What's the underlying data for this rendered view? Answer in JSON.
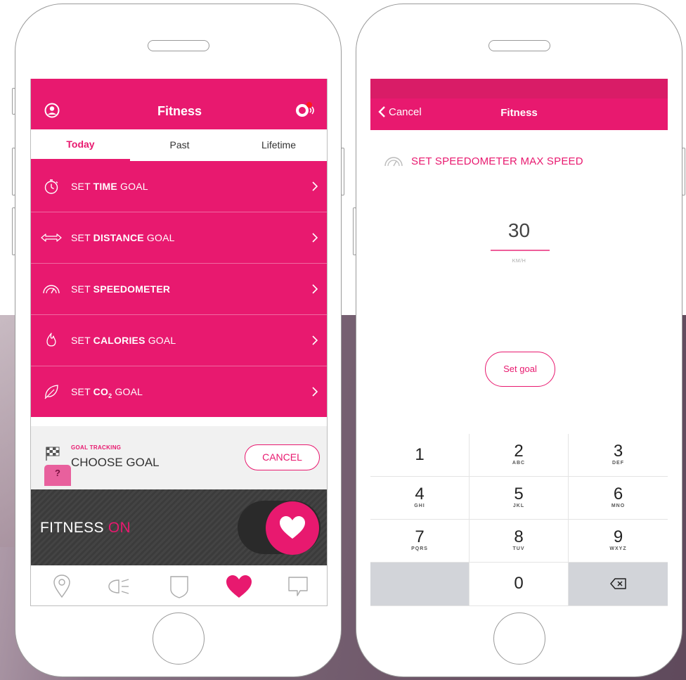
{
  "screen_a": {
    "header": {
      "title": "Fitness"
    },
    "tabs": [
      {
        "label": "Today"
      },
      {
        "label": "Past"
      },
      {
        "label": "Lifetime"
      }
    ],
    "menu": [
      {
        "pre": "SET ",
        "bold": "TIME",
        "post": " GOAL",
        "icon": "stopwatch-icon"
      },
      {
        "pre": "SET ",
        "bold": "DISTANCE",
        "post": " GOAL",
        "icon": "distance-arrows-icon"
      },
      {
        "pre": "SET ",
        "bold": "SPEEDOMETER",
        "post": "",
        "icon": "speedometer-icon"
      },
      {
        "pre": "SET ",
        "bold": "CALORIES",
        "post": " GOAL",
        "icon": "flame-icon"
      },
      {
        "pre": "SET ",
        "bold": "CO",
        "sub": "2",
        "post": " GOAL",
        "icon": "leaf-icon"
      }
    ],
    "goal": {
      "small": "GOAL TRACKING",
      "big": "CHOOSE GOAL",
      "cancel": "CANCEL",
      "help": "?"
    },
    "fitness": {
      "label": "FITNESS",
      "state": "ON"
    },
    "tabbar": [
      "location-pin-icon",
      "headlight-icon",
      "shield-icon",
      "heart-icon",
      "chat-bubble-icon"
    ]
  },
  "screen_b": {
    "header": {
      "back": "Cancel",
      "title": "Fitness"
    },
    "heading": "SET SPEEDOMETER MAX SPEED",
    "value": "30",
    "unit": "KM/H",
    "set_goal": "Set goal",
    "keys": [
      {
        "digit": "1",
        "letters": ""
      },
      {
        "digit": "2",
        "letters": "ABC"
      },
      {
        "digit": "3",
        "letters": "DEF"
      },
      {
        "digit": "4",
        "letters": "GHI"
      },
      {
        "digit": "5",
        "letters": "JKL"
      },
      {
        "digit": "6",
        "letters": "MNO"
      },
      {
        "digit": "7",
        "letters": "PQRS"
      },
      {
        "digit": "8",
        "letters": "TUV"
      },
      {
        "digit": "9",
        "letters": "WXYZ"
      },
      {
        "digit": "0",
        "letters": ""
      }
    ]
  },
  "colors": {
    "brand_pink": "#e8196f",
    "dark_bar": "#3b3b3b"
  }
}
